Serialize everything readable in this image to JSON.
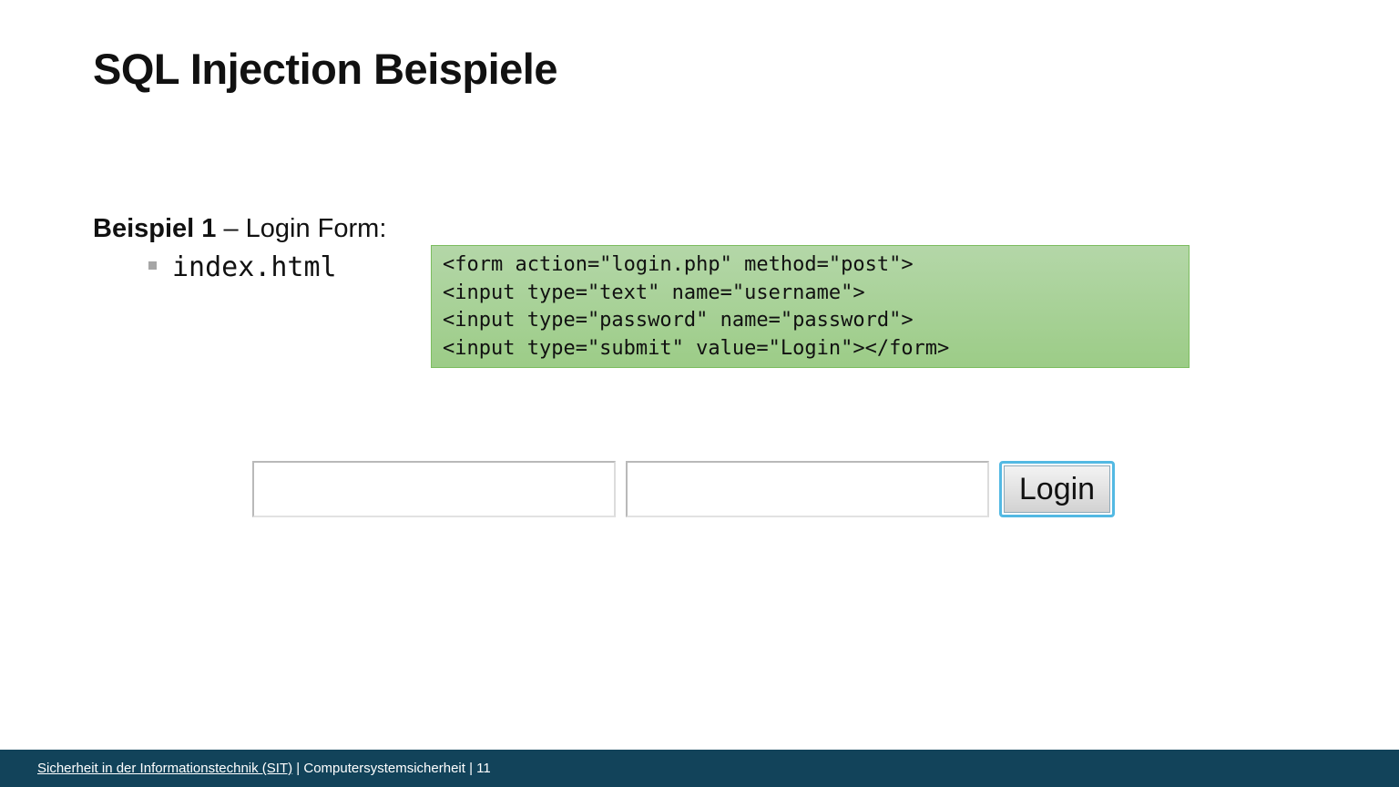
{
  "slide": {
    "title": "SQL Injection Beispiele",
    "example": {
      "label_bold": "Beispiel 1",
      "label_rest": " – Login Form:"
    },
    "bullets": [
      {
        "text": "index.html"
      }
    ]
  },
  "code_box": {
    "lines": [
      "<form action=\"login.php\" method=\"post\">",
      "<input type=\"text\" name=\"username\">",
      "<input type=\"password\" name=\"password\">",
      "<input type=\"submit\" value=\"Login\"></form>"
    ],
    "background_color": "#a9d39a",
    "border_color": "#7cbd5f"
  },
  "login_form": {
    "username_value": "",
    "password_value": "",
    "submit_label": "Login"
  },
  "footer": {
    "link_text": "Sicherheit in der Informationstechnik (SIT)",
    "separator_1": " | ",
    "course": "Computersystemsicherheit",
    "separator_2": " | ",
    "page_number": "11",
    "background_color": "#12435a"
  }
}
